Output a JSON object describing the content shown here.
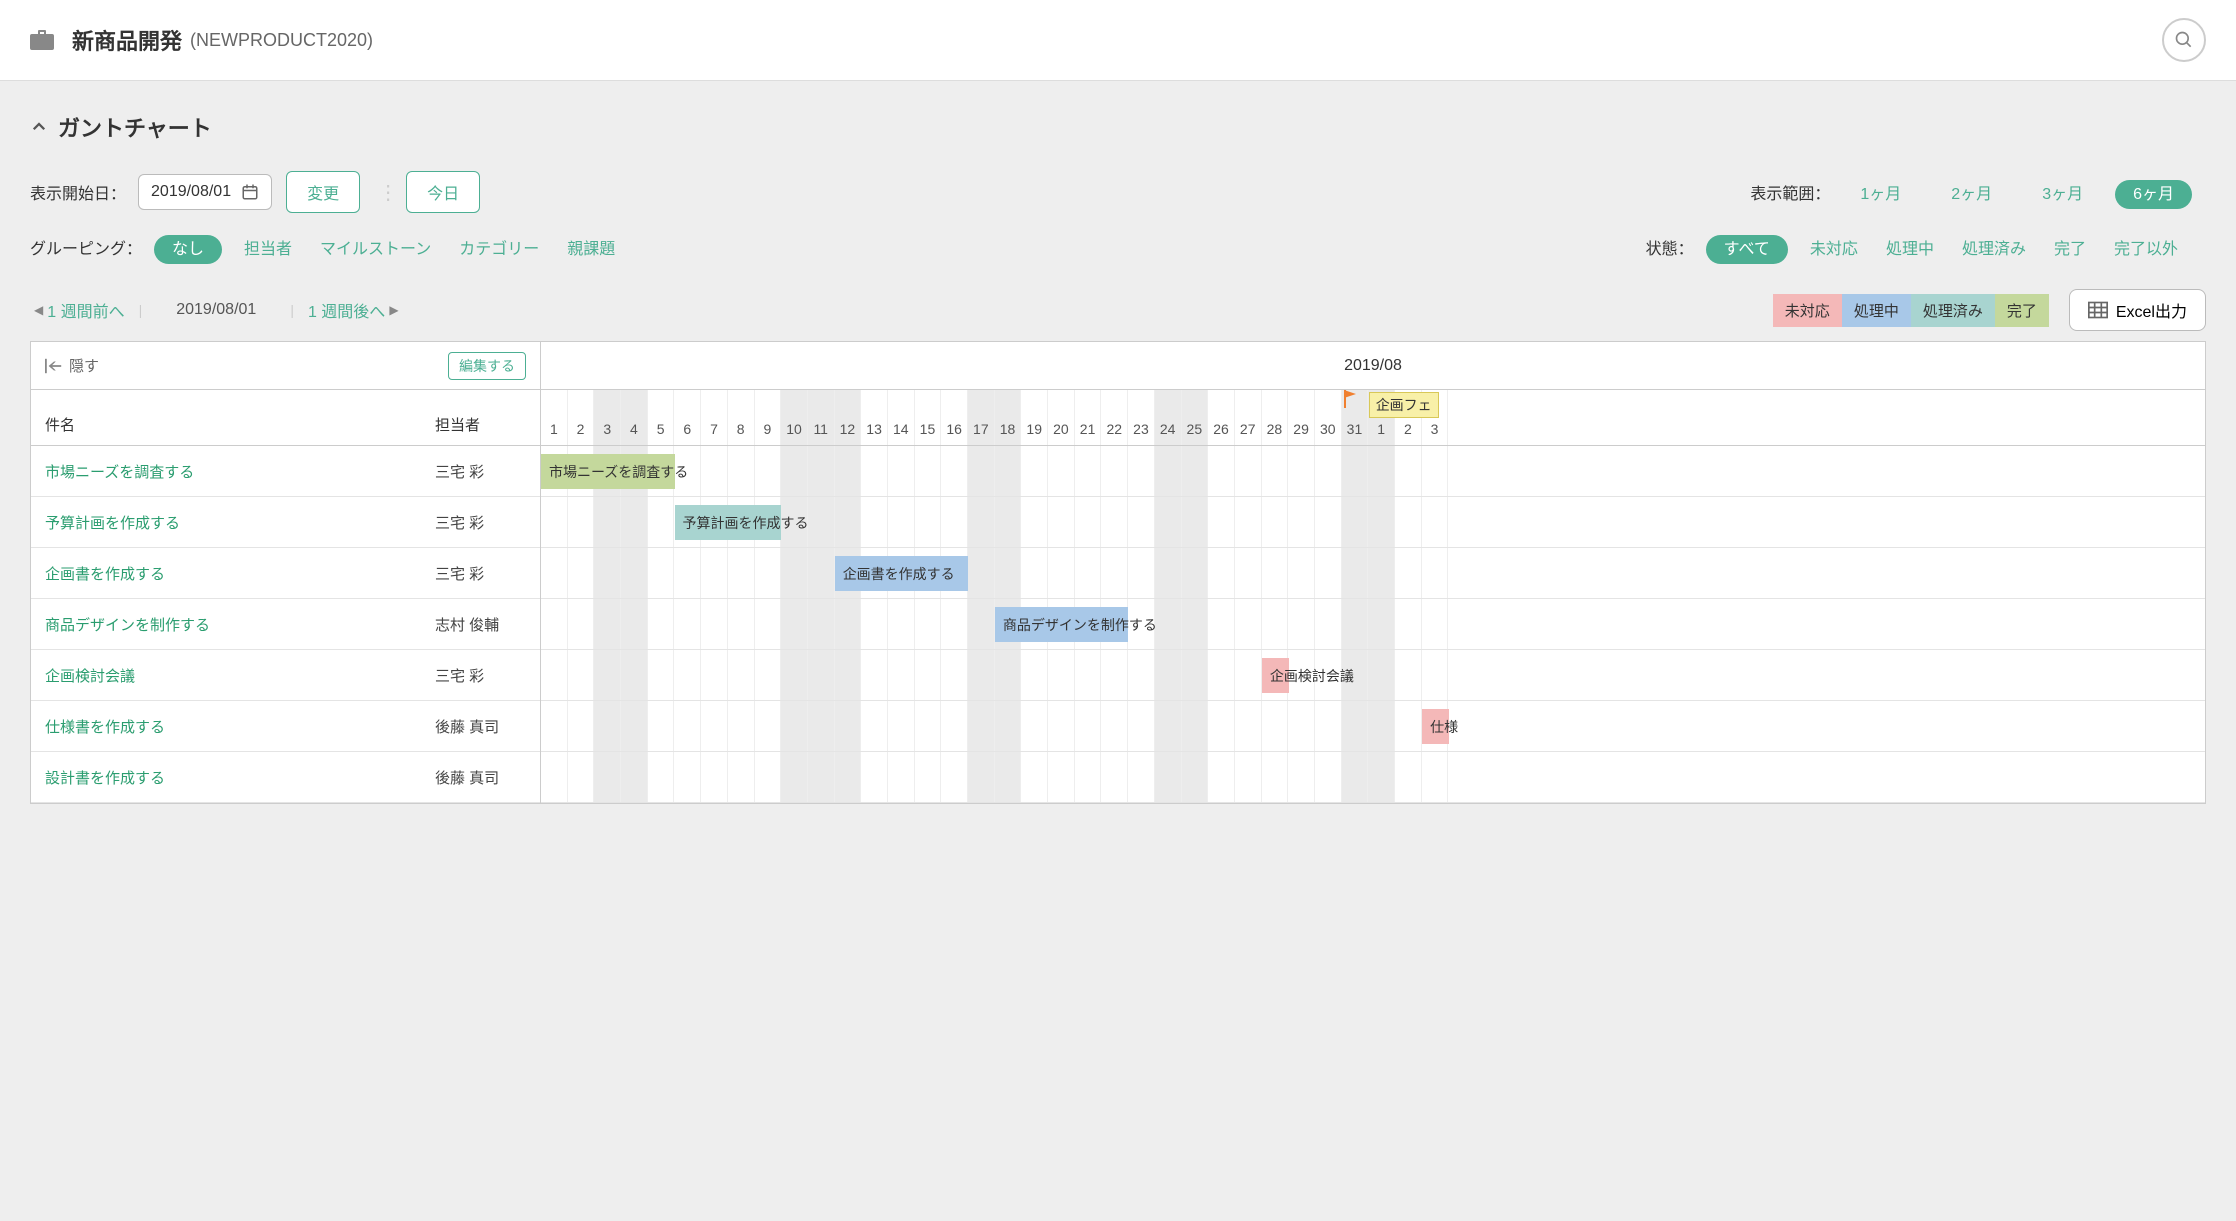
{
  "header": {
    "project_title": "新商品開発",
    "project_key": "(NEWPRODUCT2020)"
  },
  "section_title": "ガントチャート",
  "controls": {
    "start_date_label": "表示開始日：",
    "start_date_value": "2019/08/01",
    "change_btn": "変更",
    "today_btn": "今日",
    "range_label": "表示範囲：",
    "range_options": [
      "1ヶ月",
      "2ヶ月",
      "3ヶ月",
      "6ヶ月"
    ],
    "range_active": 3,
    "grouping_label": "グルーピング：",
    "grouping_options": [
      "なし",
      "担当者",
      "マイルストーン",
      "カテゴリー",
      "親課題"
    ],
    "grouping_active": 0,
    "status_label": "状態：",
    "status_options": [
      "すべて",
      "未対応",
      "処理中",
      "処理済み",
      "完了",
      "完了以外"
    ],
    "status_active": 0
  },
  "nav": {
    "prev": "1 週間前へ",
    "date": "2019/08/01",
    "next": "1 週間後へ"
  },
  "legend": {
    "not_started": "未対応",
    "in_progress": "処理中",
    "processed": "処理済み",
    "done": "完了"
  },
  "excel_btn": "Excel出力",
  "table": {
    "hide_btn": "隠す",
    "edit_btn": "編集する",
    "col_subject": "件名",
    "col_assignee": "担当者",
    "month_header": "2019/08",
    "milestone_label": "企画フェ"
  },
  "days": [
    {
      "d": "1",
      "w": false
    },
    {
      "d": "2",
      "w": false
    },
    {
      "d": "3",
      "w": true
    },
    {
      "d": "4",
      "w": true
    },
    {
      "d": "5",
      "w": false
    },
    {
      "d": "6",
      "w": false
    },
    {
      "d": "7",
      "w": false
    },
    {
      "d": "8",
      "w": false
    },
    {
      "d": "9",
      "w": false
    },
    {
      "d": "10",
      "w": true
    },
    {
      "d": "11",
      "w": true
    },
    {
      "d": "12",
      "w": true
    },
    {
      "d": "13",
      "w": false
    },
    {
      "d": "14",
      "w": false
    },
    {
      "d": "15",
      "w": false
    },
    {
      "d": "16",
      "w": false
    },
    {
      "d": "17",
      "w": true
    },
    {
      "d": "18",
      "w": true
    },
    {
      "d": "19",
      "w": false
    },
    {
      "d": "20",
      "w": false
    },
    {
      "d": "21",
      "w": false
    },
    {
      "d": "22",
      "w": false
    },
    {
      "d": "23",
      "w": false
    },
    {
      "d": "24",
      "w": true
    },
    {
      "d": "25",
      "w": true
    },
    {
      "d": "26",
      "w": false
    },
    {
      "d": "27",
      "w": false
    },
    {
      "d": "28",
      "w": false
    },
    {
      "d": "29",
      "w": false
    },
    {
      "d": "30",
      "w": false
    },
    {
      "d": "31",
      "w": true
    },
    {
      "d": "1",
      "w": true
    },
    {
      "d": "2",
      "w": false
    },
    {
      "d": "3",
      "w": false
    }
  ],
  "tasks": [
    {
      "name": "市場ニーズを調査する",
      "assignee": "三宅 彩",
      "start": 0,
      "span": 5,
      "color": "green",
      "bar_label": "市場ニーズを調査する"
    },
    {
      "name": "予算計画を作成する",
      "assignee": "三宅 彩",
      "start": 5,
      "span": 4,
      "color": "teal",
      "bar_label": "予算計画を作成する"
    },
    {
      "name": "企画書を作成する",
      "assignee": "三宅 彩",
      "start": 11,
      "span": 5,
      "color": "blue",
      "bar_label": "企画書を作成する"
    },
    {
      "name": "商品デザインを制作する",
      "assignee": "志村 俊輔",
      "start": 17,
      "span": 5,
      "color": "blue",
      "bar_label": "商品デザインを制作する"
    },
    {
      "name": "企画検討会議",
      "assignee": "三宅 彩",
      "start": 27,
      "span": 1,
      "color": "red",
      "bar_label": "企画検討会議"
    },
    {
      "name": "仕様書を作成する",
      "assignee": "後藤 真司",
      "start": 33,
      "span": 1,
      "color": "red",
      "bar_label": "仕様"
    },
    {
      "name": "設計書を作成する",
      "assignee": "後藤 真司",
      "start": -1,
      "span": 0,
      "color": "",
      "bar_label": ""
    }
  ]
}
